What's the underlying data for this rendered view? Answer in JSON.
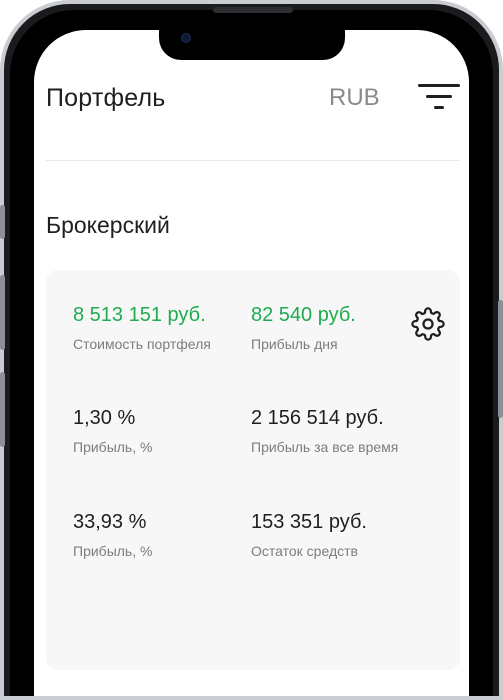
{
  "header": {
    "title": "Портфель",
    "currency": "RUB"
  },
  "section": {
    "title": "Брокерский"
  },
  "metrics": [
    {
      "value": "8 513 151 руб.",
      "label": "Стоимость портфеля",
      "color": "#1fab4f"
    },
    {
      "value": "82 540 руб.",
      "label": "Прибыль дня",
      "color": "#1fab4f"
    },
    {
      "value": "1,30 %",
      "label": "Прибыль, %",
      "color": "#1f1f1f"
    },
    {
      "value": "2 156 514 руб.",
      "label": "Прибыль за все время",
      "color": "#1f1f1f"
    },
    {
      "value": "33,93 %",
      "label": "Прибыль, %",
      "color": "#1f1f1f"
    },
    {
      "value": "153 351 руб.",
      "label": "Остаток средств",
      "color": "#1f1f1f"
    }
  ],
  "icons": {
    "filter": "filter-icon",
    "settings": "gear-icon"
  },
  "colors": {
    "positive": "#1fab4f",
    "text": "#1f1f1f",
    "muted": "#7d7d7d",
    "card": "#f7f7f7"
  }
}
